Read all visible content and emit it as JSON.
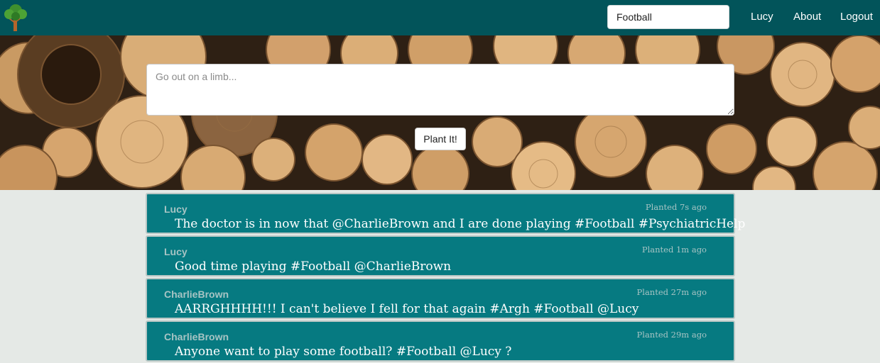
{
  "nav": {
    "search_value": "Football",
    "links": [
      "Lucy",
      "About",
      "Logout"
    ]
  },
  "compose": {
    "placeholder": "Go out on a limb...",
    "button_label": "Plant It!"
  },
  "posts": [
    {
      "author": "Lucy",
      "time": "Planted 7s ago",
      "text": "The doctor is in now that @CharlieBrown and I are done playing #Football #PsychiatricHelp"
    },
    {
      "author": "Lucy",
      "time": "Planted 1m ago",
      "text": "Good time playing #Football @CharlieBrown"
    },
    {
      "author": "CharlieBrown",
      "time": "Planted 27m ago",
      "text": "AARRGHHHH!!! I can't believe I fell for that again #Argh #Football @Lucy"
    },
    {
      "author": "CharlieBrown",
      "time": "Planted 29m ago",
      "text": "Anyone want to play some football? #Football @Lucy ?"
    }
  ],
  "colors": {
    "navbar": "#02545a",
    "post_card": "#067a81",
    "page_background": "#e5e9e6"
  }
}
